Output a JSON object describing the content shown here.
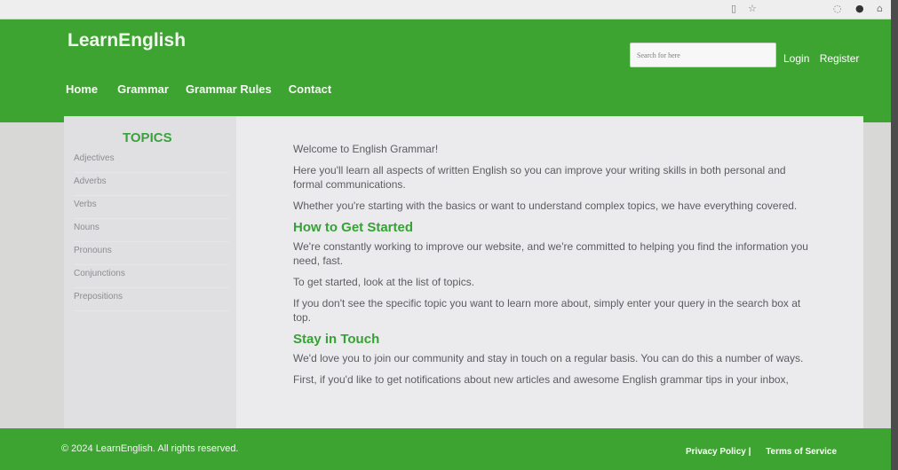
{
  "browser": {
    "icons": [
      "reader-icon",
      "star-icon",
      "shield-icon",
      "circle-icon",
      "extensions-icon"
    ]
  },
  "header": {
    "logo": "LearnEnglish",
    "search_placeholder": "Search for here",
    "login": "Login",
    "register": "Register"
  },
  "nav": [
    "Home",
    "Grammar",
    "Grammar Rules",
    "Contact"
  ],
  "sidebar": {
    "title": "TOPICS",
    "items": [
      "Adjectives",
      "Adverbs",
      "Verbs",
      "Nouns",
      "Pronouns",
      "Conjunctions",
      "Prepositions"
    ]
  },
  "content": {
    "p1": "Welcome to English Grammar!",
    "p2": "Here you'll learn all aspects of written English so you can improve your writing skills in both personal and formal communications.",
    "p3": "Whether you're starting with the basics or want to understand complex topics, we have everything covered.",
    "h1": "How to Get Started",
    "p4": "We're constantly working to improve our website, and we're committed to helping you find the information you need, fast.",
    "p5": "To get started, look at the list of topics.",
    "p6": "If you don't see the specific topic you want to learn more about, simply enter your query in the search box at top.",
    "h2": "Stay in Touch",
    "p7": "We'd love you to join our community and stay in touch on a regular basis. You can do this a number of ways.",
    "p8": "First, if you'd like to get notifications about new articles and awesome English grammar tips in your inbox,"
  },
  "footer": {
    "copyright": "© 2024 LearnEnglish. All rights reserved.",
    "privacy": "Privacy Policy |",
    "terms": "Terms of Service"
  }
}
